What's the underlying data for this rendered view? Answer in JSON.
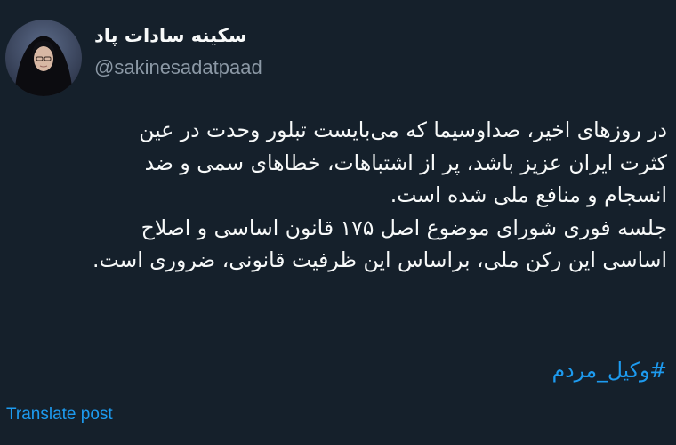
{
  "author": {
    "display_name": "سکینه سادات پاد",
    "handle": "@sakinesadatpaad"
  },
  "post": {
    "lines": [
      "در روزهای اخیر، صداوسیما که می‌بایست تبلور وحدت در عین",
      "کثرت ایران عزیز باشد، پر از اشتباهات، خطاهای سمی و ضد",
      "انسجام و منافع ملی شده است.",
      "جلسه فوری شورای موضوع اصل ۱۷۵ قانون اساسی و اصلاح",
      "اساسی این رکن ملی، براساس این ظرفیت قانونی، ضروری است."
    ],
    "hashtag": "#وکیل_مردم"
  },
  "actions": {
    "translate_label": "Translate post"
  },
  "colors": {
    "background": "#15202b",
    "text": "#f7f9f9",
    "secondary": "#8b98a5",
    "link": "#1d9bf0"
  },
  "icons": {
    "avatar": "profile-photo"
  }
}
